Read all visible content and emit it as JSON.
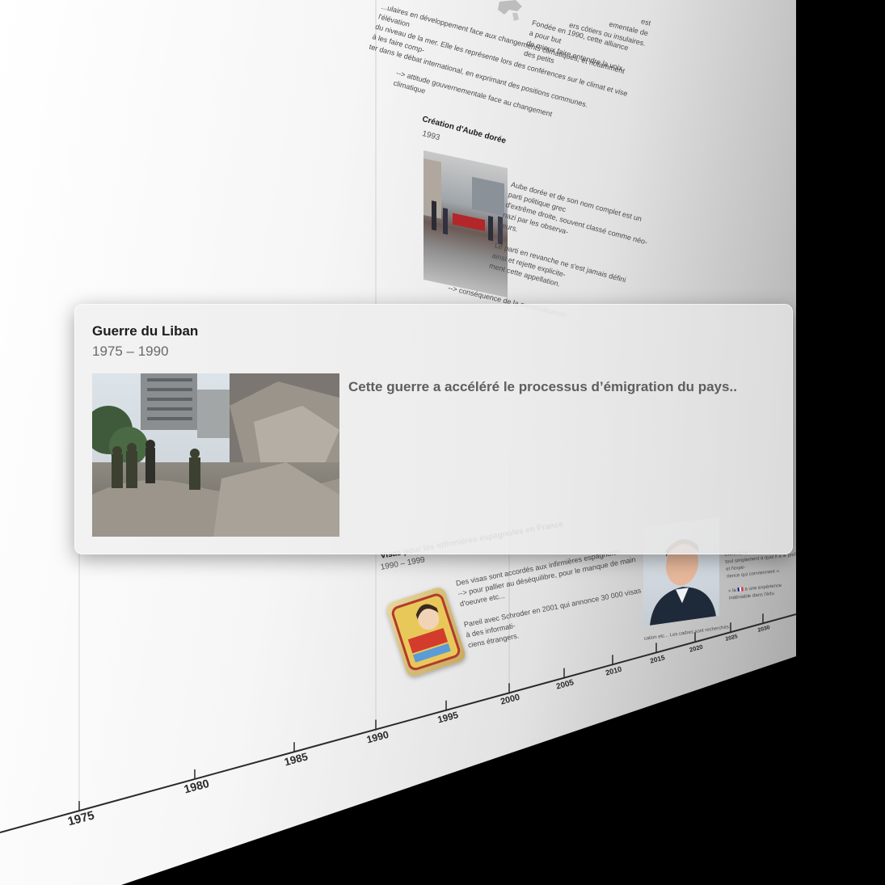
{
  "timeline": {
    "axis_labels": [
      "1975",
      "1980",
      "1985",
      "1990",
      "1995",
      "2000",
      "2005",
      "2010",
      "2015",
      "2020",
      "2025",
      "2030"
    ]
  },
  "background_events": {
    "alliance": {
      "top_fragments": [
        "est",
        "ementale de",
        "ers côtiers ou insulaires."
      ],
      "left_lines": [
        "...ulaires en développement face aux changements climatiques, et notamment l'élévation",
        "du niveau de la mer. Elle les représente lors des conférences sur le climat et vise à les faire comp-",
        "ter dans le débat international, en exprimant des positions communes."
      ],
      "right_lines": [
        "Fondée en 1990, cette alliance a pour but",
        "de mieux faire entendre la voix des petits"
      ],
      "arrow_note": "--> attitude gouvernementale face au changement climatique"
    },
    "aube_doree": {
      "title": "Création d'Aube dorée",
      "date": "1993",
      "para1": [
        "Aube dorée et de son nom complet est un parti politique grec",
        "d'extrême droite, souvent classé comme néo-nazi par les observa-",
        "teurs."
      ],
      "para2": [
        "Le parti en revanche ne s'est jamais défini ainsi et rejette explicite-",
        "ment cette appellation."
      ],
      "arrow_note": "--> conséquence de la mondialisation"
    },
    "visas": {
      "title": "Visas pour les infirmières espagnoles en France",
      "date": "1990 – 1999",
      "lines": [
        "Des visas sont accordés aux infirmières espagnoles",
        "--> pour pallier au déséquilibre, pour le manque de main d'oeuvre etc...",
        "",
        "Pareil avec Schroder en 2001 qui annonce 30 000 visas à des informati-",
        "ciens étrangers."
      ]
    },
    "right_event": {
      "lines": [
        "Christophe",
        "tout simplement à quoi il a le profil et l'expe-",
        "rience qui conviennent ».",
        "",
        "» la 🇫🇷 a une expérience indéniable dans l'édu"
      ],
      "caption": "cation etc... Les cadres sont recherchés."
    }
  },
  "card": {
    "title": "Guerre du Liban",
    "dates": "1975 – 1990",
    "description": "Cette guerre a accéléré le processus d’émigration du pays.."
  }
}
